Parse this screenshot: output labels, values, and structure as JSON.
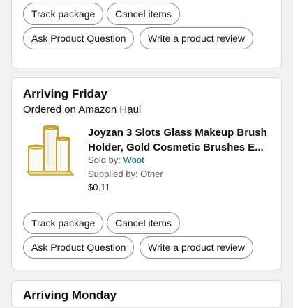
{
  "top_card": {
    "track_label": "Track package",
    "cancel_label": "Cancel items",
    "ask_label": "Ask Product Question",
    "review_label": "Write a product review"
  },
  "order": {
    "status_title": "Arriving Friday",
    "ordered_on": "Ordered on Amazon Haul",
    "product_title": "Joyzan 3 Slots Glass Makeup Brush Holder, Gold Cosmetic Brushes E...",
    "sold_by_label": "Sold by:",
    "seller": "Woot",
    "supplied_by": "Supplied by: Other",
    "price": "$0.11",
    "track_label": "Track package",
    "cancel_label": "Cancel items",
    "ask_label": "Ask Product Question",
    "review_label": "Write a product review"
  },
  "next_card": {
    "status_title": "Arriving Monday"
  },
  "colors": {
    "page_bg": "#f0f2f2",
    "link": "#007185",
    "border": "#d5d9d9",
    "gold": "#c9a227"
  }
}
